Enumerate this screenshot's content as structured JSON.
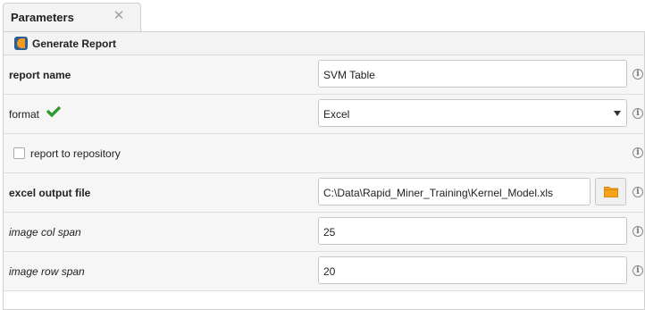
{
  "tab": {
    "title": "Parameters",
    "close_icon": "close-icon"
  },
  "operator": {
    "title": "Generate Report",
    "icon": "report-operator-icon"
  },
  "parameters": {
    "report_name": {
      "label": "report name",
      "value": "SVM Table"
    },
    "format": {
      "label": "format",
      "value": "Excel",
      "status_icon": "green-check-icon"
    },
    "report_to_repository": {
      "label": "report to repository",
      "checked": false
    },
    "excel_output_file": {
      "label": "excel output file",
      "value": "C:\\Data\\Rapid_Miner_Training\\Kernel_Model.xls",
      "button_icon": "folder-icon"
    },
    "image_col_span": {
      "label": "image col span",
      "value": "25"
    },
    "image_row_span": {
      "label": "image row span",
      "value": "20"
    }
  },
  "info_icon": "info-icon",
  "colors": {
    "panel_bg": "#f3f3f3",
    "row_bg": "#f6f6f6",
    "check_green": "#2e9a2e",
    "folder_orange": "#f4a21a",
    "operator_icon_blue": "#2b5d97",
    "operator_icon_orange": "#f29a1f"
  }
}
